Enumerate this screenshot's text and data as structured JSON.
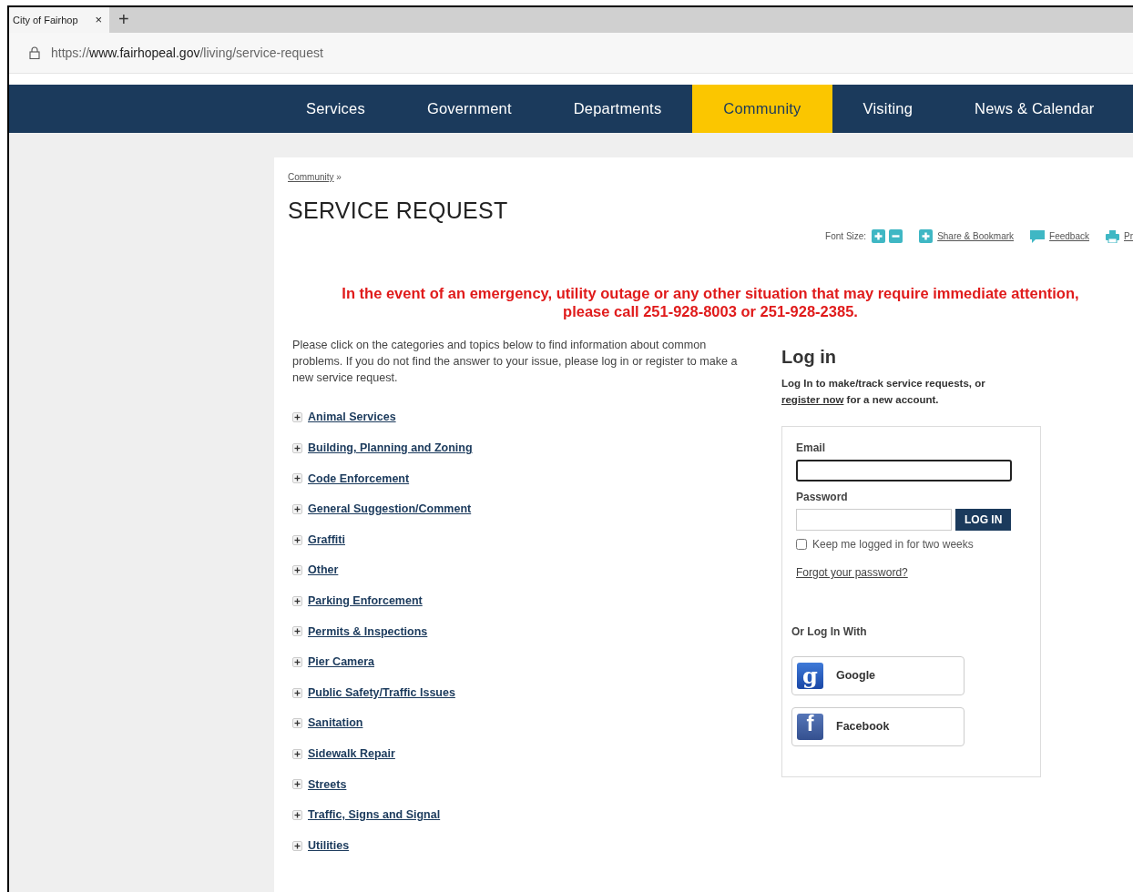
{
  "browser": {
    "tab_title": "City of Fairhop",
    "tab_close": "×",
    "new_tab": "+",
    "url_scheme": "https://",
    "url_host": "www.fairhopeal.gov",
    "url_path": "/living/service-request"
  },
  "nav": [
    {
      "label": "Services",
      "selected": false
    },
    {
      "label": "Government",
      "selected": false
    },
    {
      "label": "Departments",
      "selected": false
    },
    {
      "label": "Community",
      "selected": true
    },
    {
      "label": "Visiting",
      "selected": false
    },
    {
      "label": "News & Calendar",
      "selected": false
    }
  ],
  "breadcrumb": {
    "link": "Community",
    "separator": "»"
  },
  "title": "SERVICE REQUEST",
  "tools": {
    "font_size_label": "Font Size:",
    "links": [
      {
        "kind": "share",
        "label": "Share & Bookmark"
      },
      {
        "kind": "feedback",
        "label": "Feedback"
      },
      {
        "kind": "print",
        "label": "Pr"
      }
    ]
  },
  "alert": [
    "In the event of an emergency, utility outage or any other situation that may require immediate attention,",
    "please call 251-928-8003 or 251-928-2385."
  ],
  "intro": "Please click on the categories and topics below to find information about common problems. If you do not find the answer to your issue, please log in or register to make a new service request.",
  "categories": [
    {
      "label": "Animal Services",
      "expanded": false
    },
    {
      "label": "Building, Planning and Zoning",
      "expanded": false
    },
    {
      "label": "Code Enforcement",
      "expanded": false
    },
    {
      "label": "General Suggestion/Comment",
      "expanded": false
    },
    {
      "label": "Graffiti",
      "expanded": false
    },
    {
      "label": "Other",
      "expanded": false
    },
    {
      "label": "Parking Enforcement",
      "expanded": false
    },
    {
      "label": "Permits & Inspections",
      "expanded": false
    },
    {
      "label": "Pier Camera",
      "expanded": false
    },
    {
      "label": "Public Safety/Traffic Issues",
      "expanded": false
    },
    {
      "label": "Sanitation",
      "expanded": false
    },
    {
      "label": "Sidewalk Repair",
      "expanded": false
    },
    {
      "label": "Streets",
      "expanded": false
    },
    {
      "label": "Traffic, Signs and Signal",
      "expanded": false
    },
    {
      "label": "Utilities",
      "expanded": false
    }
  ],
  "login": {
    "heading": "Log in",
    "text_before": "Log In to make/track service requests, or",
    "register_link": "register now",
    "text_after": "for a new account.",
    "email_label": "Email",
    "email_focused": true,
    "password_label": "Password",
    "login_button": "LOG IN",
    "remember_label": "Keep me logged in for two weeks",
    "remember_checked": false,
    "forgot_link": "Forgot your password?",
    "social_heading": "Or Log In With",
    "providers": [
      {
        "kind": "google",
        "icon": "g",
        "label": "Google"
      },
      {
        "kind": "facebook",
        "icon": "f",
        "label": "Facebook"
      }
    ]
  }
}
